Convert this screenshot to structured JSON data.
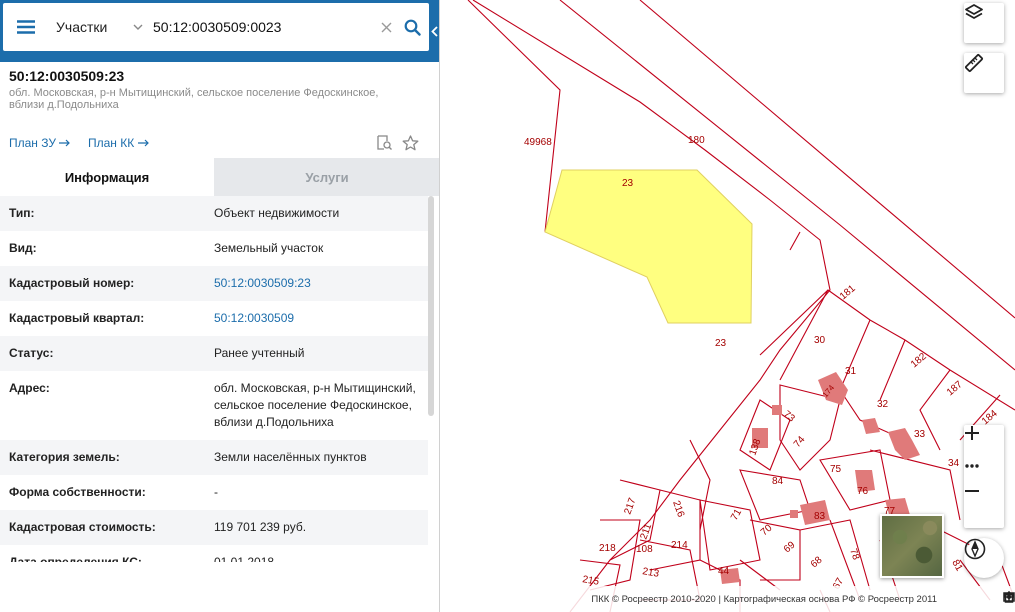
{
  "search": {
    "type_label": "Участки",
    "query": "50:12:0030509:0023"
  },
  "object": {
    "title": "50:12:0030509:23",
    "address": "обл. Московская, р-н Мытищинский, сельское поселение Федоскинское, вблизи д.Подольниха"
  },
  "links": {
    "plan_zu": "План ЗУ",
    "plan_kk": "План КК"
  },
  "tabs": [
    {
      "label": "Информация"
    },
    {
      "label": "Услуги"
    }
  ],
  "info": [
    {
      "key": "Тип:",
      "value": "Объект недвижимости"
    },
    {
      "key": "Вид:",
      "value": "Земельный участок"
    },
    {
      "key": "Кадастровый номер:",
      "value": "50:12:0030509:23"
    },
    {
      "key": "Кадастровый квартал:",
      "value": "50:12:0030509"
    },
    {
      "key": "Статус:",
      "value": "Ранее учтенный"
    },
    {
      "key": "Адрес:",
      "value": "обл. Московская, р-н Мытищинский, сельское поселение Федоскинское, вблизи д.Подольниха"
    },
    {
      "key": "Категория земель:",
      "value": "Земли населённых пунктов"
    },
    {
      "key": "Форма собственности:",
      "value": "-"
    },
    {
      "key": "Кадастровая стоимость:",
      "value": "119 701 239 руб."
    },
    {
      "key": "Дата определения КС:",
      "value": "01.01.2018"
    }
  ],
  "map": {
    "parcel_labels": {
      "l49968": "49968",
      "l180": "180",
      "l23a": "23",
      "l23b": "23",
      "l181": "181",
      "l30": "30",
      "l31": "31",
      "l32": "32",
      "l33": "33",
      "l34": "34",
      "l182": "182",
      "l187": "187",
      "l184": "184",
      "l73": "73",
      "l74": "74",
      "l75": "75",
      "l76": "76",
      "l77": "77",
      "l78": "78",
      "l84": "84",
      "l83": "83",
      "l138": "138",
      "l71": "71",
      "l70": "70",
      "l69": "69",
      "l68": "68",
      "l81": "81",
      "l67": "67",
      "l217": "217",
      "l216": "216",
      "l211": "211",
      "l108": "108",
      "l214": "214",
      "l218": "218",
      "l213": "213",
      "l215": "215",
      "l44": "44",
      "l174": "174"
    },
    "attribution": "ПКК © Росреестр 2010-2020 | Картографическая основа РФ © Росреестр 2011"
  },
  "colors": {
    "header": "#1c6dab",
    "parcel_line": "#c0001a",
    "selected_fill": "#ffff80",
    "building": "#e07a7a"
  }
}
